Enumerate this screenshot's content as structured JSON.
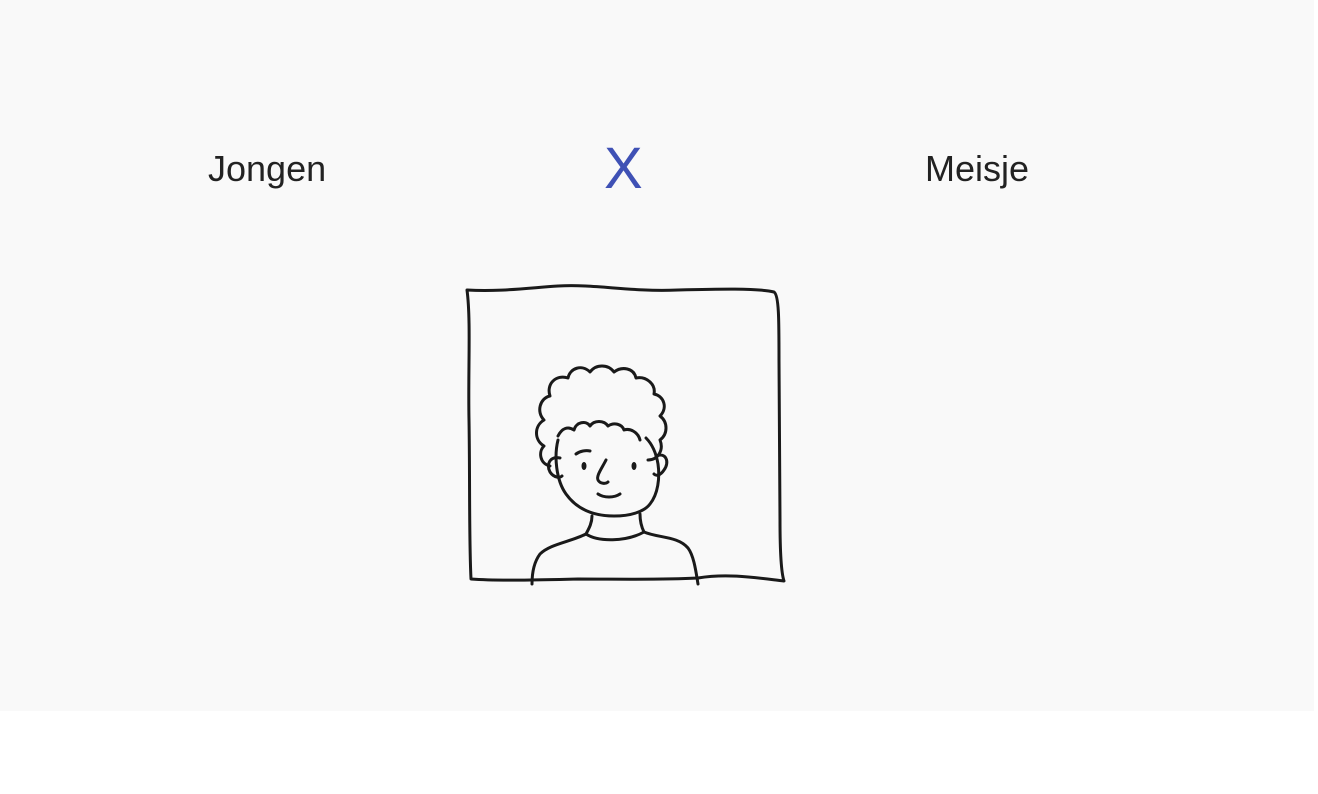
{
  "task": {
    "left_option": "Jongen",
    "right_option": "Meisje",
    "result_mark": "X"
  },
  "colors": {
    "background": "#f9f9f9",
    "text": "#222222",
    "result_mark": "#3f51b5",
    "line_art": "#1a1a1a"
  },
  "illustration": {
    "icon": "boy-with-curly-hair-sketch"
  }
}
